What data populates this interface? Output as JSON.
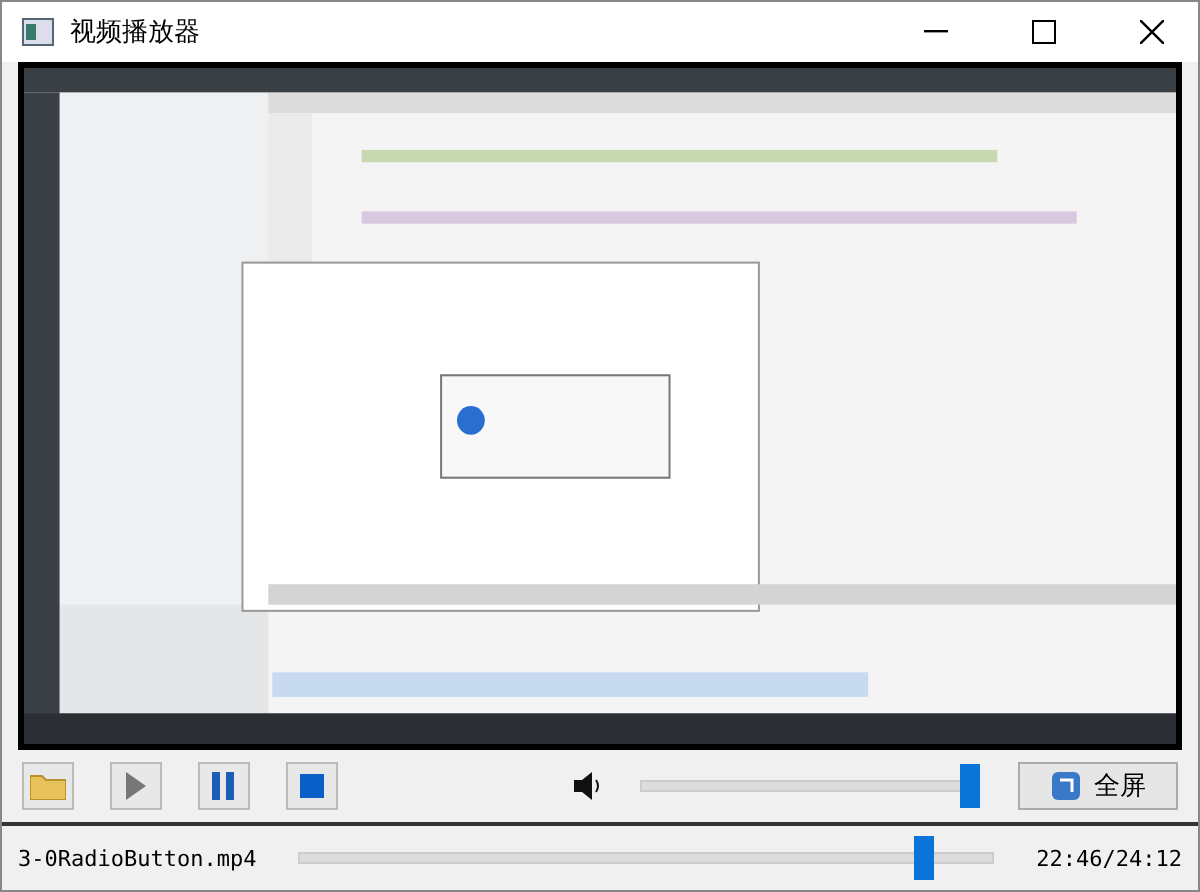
{
  "window": {
    "title": "视频播放器"
  },
  "controls": {
    "buttons": [
      {
        "kind": "open"
      },
      {
        "kind": "play"
      },
      {
        "kind": "pause"
      },
      {
        "kind": "stop"
      }
    ],
    "volume": {
      "level": 0.97
    },
    "fullscreen": "全屏"
  },
  "status": {
    "file": "3-0RadioButton.mp4",
    "progress": {
      "level": 0.9
    },
    "time": "22:46/24:12"
  }
}
